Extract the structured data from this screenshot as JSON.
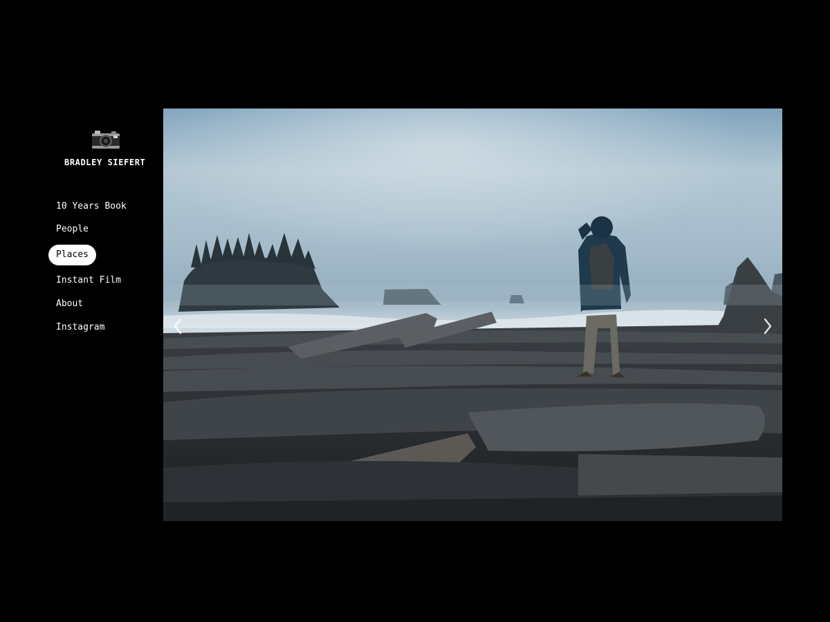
{
  "site": {
    "brand": "BRADLEY SIEFERT",
    "logo_icon": "camera-icon"
  },
  "nav": {
    "items": [
      {
        "label": "10 Years Book",
        "active": false
      },
      {
        "label": "People",
        "active": false
      },
      {
        "label": "Places",
        "active": true
      },
      {
        "label": "Instant Film",
        "active": false
      },
      {
        "label": "About",
        "active": false
      },
      {
        "label": "Instagram",
        "active": false
      }
    ]
  },
  "gallery": {
    "prev_icon": "chevron-left-icon",
    "next_icon": "chevron-right-icon"
  },
  "colors": {
    "background": "#000000",
    "text": "#ffffff",
    "active_pill": "#ffffff"
  }
}
